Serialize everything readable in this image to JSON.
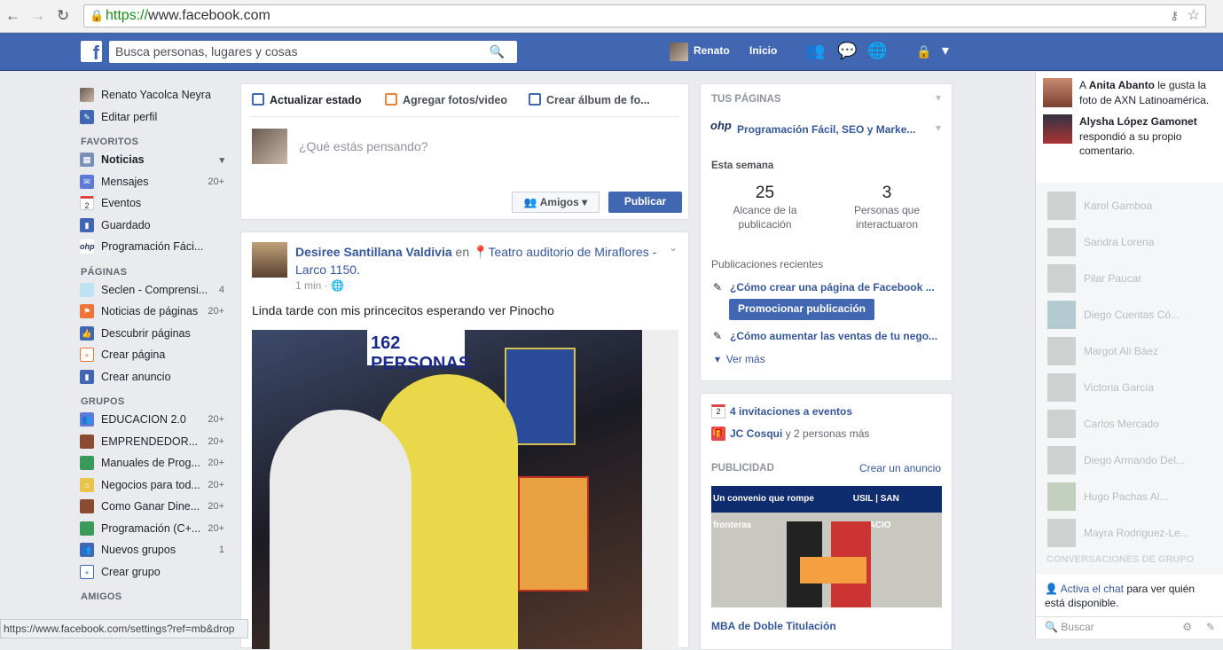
{
  "browser": {
    "url_scheme": "https://",
    "url_host": "www.facebook.com",
    "status_url": "https://www.facebook.com/settings?ref=mb&drop"
  },
  "header": {
    "logo": "f",
    "search_placeholder": "Busca personas, lugares y cosas",
    "user": "Renato",
    "home": "Inicio"
  },
  "sidebar": {
    "profile": "Renato Yacolca Neyra",
    "edit": "Editar perfil",
    "favorites_title": "FAVORITOS",
    "favorites": [
      {
        "label": "Noticias",
        "count": ""
      },
      {
        "label": "Mensajes",
        "count": "20+"
      },
      {
        "label": "Eventos",
        "count": ""
      },
      {
        "label": "Guardado",
        "count": ""
      },
      {
        "label": "Programación Fáci...",
        "count": ""
      }
    ],
    "pages_title": "PÁGINAS",
    "pages": [
      {
        "label": "Seclen - Comprensi...",
        "count": "4"
      },
      {
        "label": "Noticias de páginas",
        "count": "20+"
      },
      {
        "label": "Descubrir páginas",
        "count": ""
      },
      {
        "label": "Crear página",
        "count": ""
      },
      {
        "label": "Crear anuncio",
        "count": ""
      }
    ],
    "groups_title": "GRUPOS",
    "groups": [
      {
        "label": "EDUCACION 2.0",
        "count": "20+"
      },
      {
        "label": "EMPRENDEDOR...",
        "count": "20+"
      },
      {
        "label": "Manuales de Prog...",
        "count": "20+"
      },
      {
        "label": "Negocios para tod...",
        "count": "20+"
      },
      {
        "label": "Como Ganar Dine...",
        "count": "20+"
      },
      {
        "label": "Programación (C+...",
        "count": "20+"
      },
      {
        "label": "Nuevos grupos",
        "count": "1"
      },
      {
        "label": "Crear grupo",
        "count": ""
      }
    ],
    "friends_title": "AMIGOS"
  },
  "composer": {
    "tab_status": "Actualizar estado",
    "tab_photos": "Agregar fotos/video",
    "tab_album": "Crear álbum de fo...",
    "placeholder": "¿Qué estás pensando?",
    "audience": "Amigos",
    "publish": "Publicar"
  },
  "post": {
    "author": "Desiree Santillana Valdivia",
    "in": "en",
    "place": "Teatro auditorio de Miraflores - Larco 1150.",
    "time": "1 min ·",
    "text": "Linda tarde con mis princecitos esperando ver Pinocho",
    "photo_sign": "162 PERSONAS"
  },
  "pages_card": {
    "title": "TUS PÁGINAS",
    "page": "Programación Fácil, SEO y Marke...",
    "week": "Esta semana",
    "reach_value": "25",
    "reach_label": "Alcance de la publicación",
    "people_value": "3",
    "people_label": "Personas que interactuaron",
    "recent": "Publicaciones recientes",
    "post1": "¿Cómo crear una página de Facebook ...",
    "promote": "Promocionar publicación",
    "post2": "¿Cómo aumentar las ventas de tu nego...",
    "more": "Ver más"
  },
  "events_card": {
    "invites": "4 invitaciones a eventos",
    "birthday_name": "JC Cosqui",
    "birthday_rest": "y 2 personas más",
    "ads": "PUBLICIDAD",
    "create_ad": "Crear un anuncio",
    "ad_banner": "Un convenio que rompe fronteras",
    "ad_brand": "USIL | SAN IGNACIO",
    "ad_title": "MBA de Doble Titulación"
  },
  "chat": {
    "notifications": [
      {
        "pre": "A ",
        "name": "Anita Abanto",
        "rest": " le gusta la foto de AXN Latinoamérica."
      },
      {
        "pre": "",
        "name": "Alysha López Gamonet",
        "rest": " respondió a su propio comentario."
      }
    ],
    "friends": [
      "Karol Gamboa",
      "Sandra Lorena",
      "Pilar Paucar",
      "Diego Cuentas Có...",
      "Margot Ali Báez",
      "Victoria García",
      "Carlos Mercado",
      "Diego Armando Del...",
      "Hugo Pachas Al...",
      "Mayra Rodriguez-Le..."
    ],
    "group_conv": "CONVERSACIONES DE GRUPO",
    "activate_link": "Activa el chat",
    "activate_rest": " para ver quién está disponible.",
    "search": "Buscar"
  }
}
